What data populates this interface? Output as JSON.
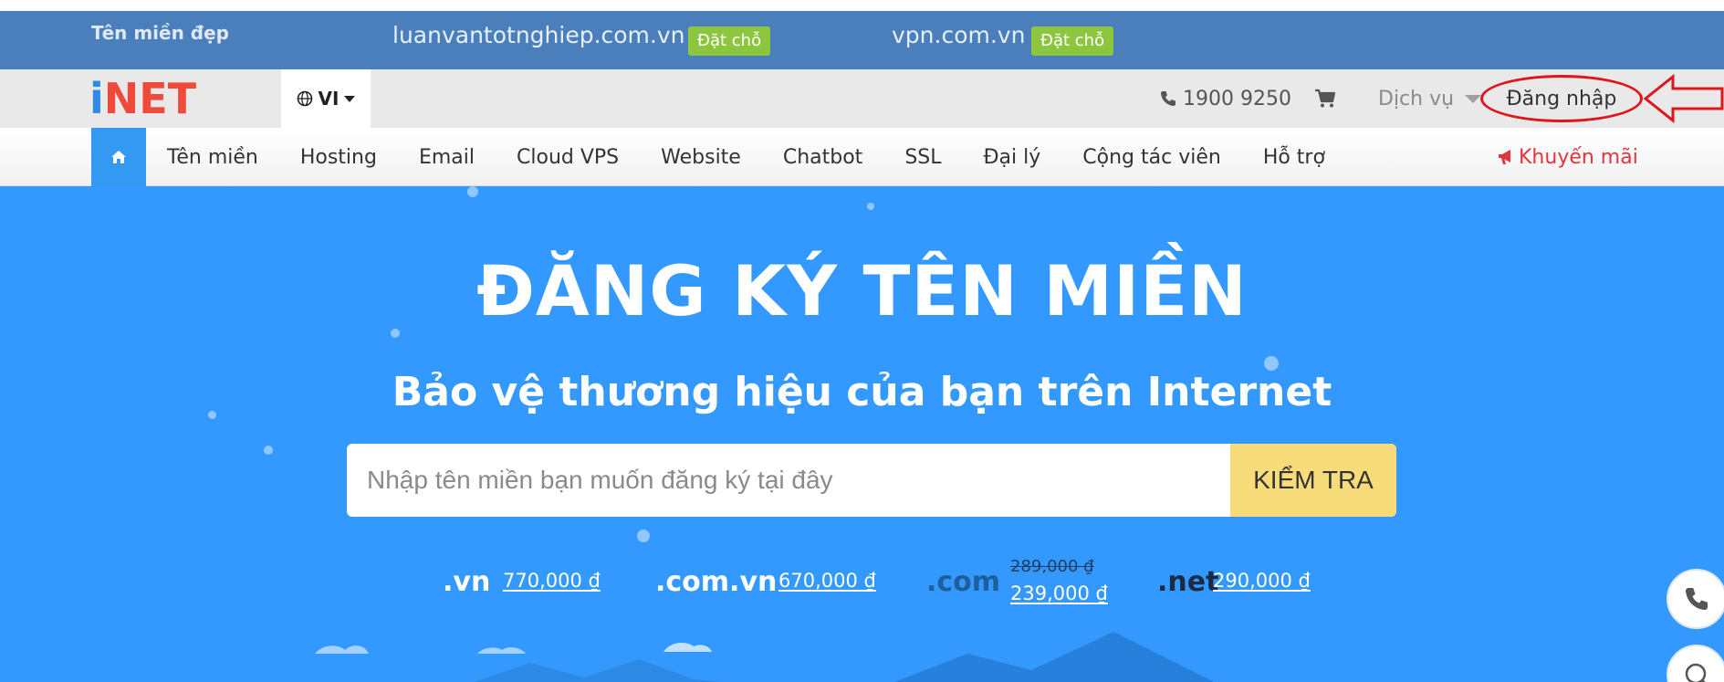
{
  "promo_bar": {
    "label": "Tên miền đẹp",
    "items": [
      {
        "domain": "luanvantotnghiep.com.vn",
        "badge": "Đặt chỗ"
      },
      {
        "domain": "vpn.com.vn",
        "badge": "Đặt chỗ"
      }
    ]
  },
  "header": {
    "logo_text": "iNET",
    "language": "VI",
    "phone": "1900 9250",
    "services": "Dịch vụ",
    "login": "Đăng nhập"
  },
  "nav": {
    "items": [
      "Tên miền",
      "Hosting",
      "Email",
      "Cloud VPS",
      "Website",
      "Chatbot",
      "SSL",
      "Đại lý",
      "Cộng tác viên",
      "Hỗ trợ"
    ],
    "promo": "Khuyến mãi"
  },
  "hero": {
    "title": "ĐĂNG KÝ TÊN MIỀN",
    "subtitle": "Bảo vệ thương hiệu của bạn trên Internet",
    "search_placeholder": "Nhập tên miền bạn muốn đăng ký tại đây",
    "search_button": "KIỂM TRA"
  },
  "pricing": [
    {
      "tld": ".vn",
      "price": "770,000 ₫"
    },
    {
      "tld": ".com.vn",
      "price": "670,000 ₫"
    },
    {
      "tld": ".com",
      "old_price": "289,000 ₫",
      "price": "239,000 ₫"
    },
    {
      "tld": ".net",
      "price": "290,000 ₫"
    }
  ],
  "colors": {
    "promo_bar": "#4a7fbb",
    "badge": "#8cc63f",
    "hero": "#3399fe",
    "search_button": "#f7dc79",
    "annotation": "#e0151c"
  }
}
